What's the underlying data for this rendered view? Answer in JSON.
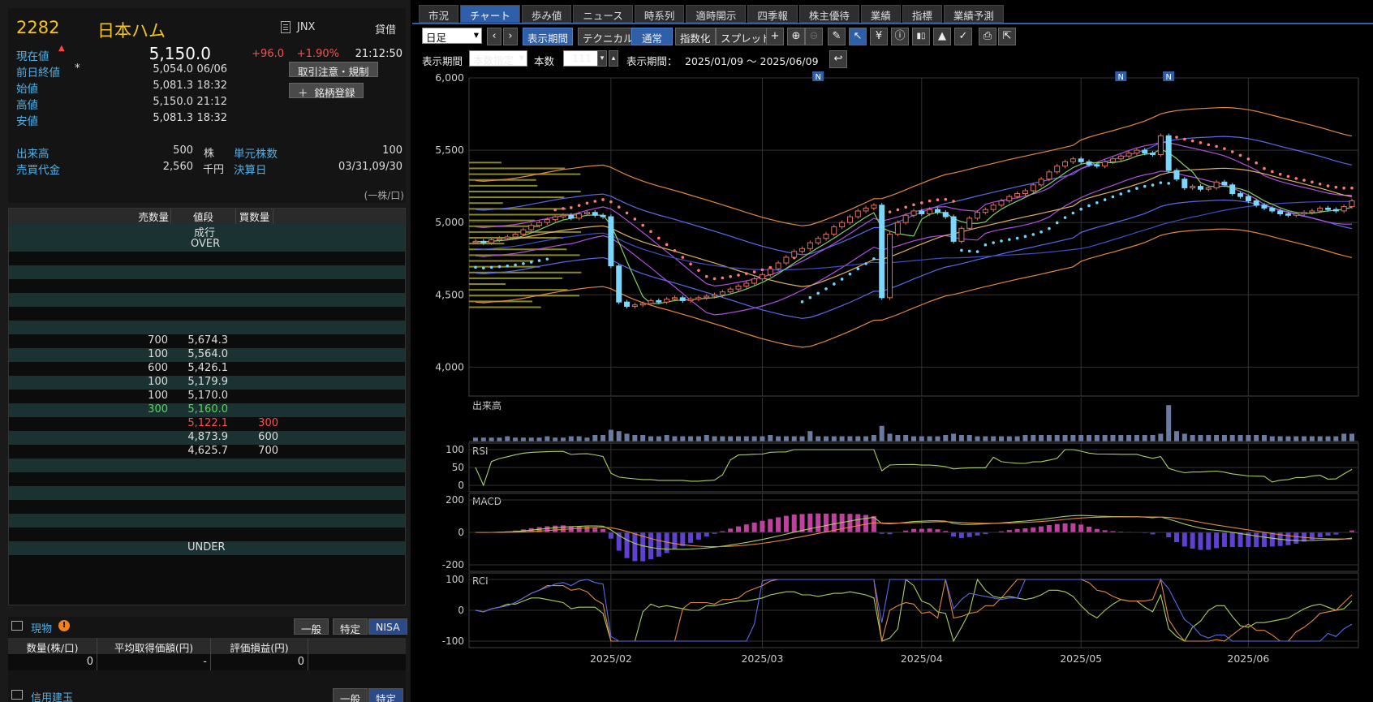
{
  "quote": {
    "code": "2282",
    "name": "日本ハム",
    "market": "JNX",
    "lend_label": "貸借",
    "current_label": "現在値",
    "current_value": "5,150.0",
    "change": "+96.0",
    "change_pct": "+1.90%",
    "time": "21:12:50",
    "prev_close_label": "前日終値",
    "prev_close_mark": "*",
    "prev_close": "5,054.0",
    "prev_close_date": "06/06",
    "open_label": "始値",
    "open": "5,081.3",
    "open_time": "18:32",
    "high_label": "高値",
    "high": "5,150.0",
    "high_time": "21:12",
    "low_label": "安値",
    "low": "5,081.3",
    "low_time": "18:32",
    "volume_label": "出来高",
    "volume": "500",
    "volume_unit": "株",
    "unit_shares_label": "単元株数",
    "unit_shares": "100",
    "turnover_label": "売買代金",
    "turnover": "2,560",
    "turnover_unit": "千円",
    "settlement_label": "決算日",
    "settlement": "03/31,09/30",
    "per_note": "(一株/口)",
    "btn_notice": "取引注意・規制",
    "btn_register": "銘柄登録"
  },
  "board": {
    "headers": [
      "売数量",
      "値段",
      "買数量"
    ],
    "market_order": "成行",
    "over": "OVER",
    "under": "UNDER",
    "rows": [
      {
        "sell": "700",
        "price": "5,674.3",
        "buy": ""
      },
      {
        "sell": "100",
        "price": "5,564.0",
        "buy": ""
      },
      {
        "sell": "600",
        "price": "5,426.1",
        "buy": ""
      },
      {
        "sell": "100",
        "price": "5,179.9",
        "buy": ""
      },
      {
        "sell": "100",
        "price": "5,170.0",
        "buy": ""
      },
      {
        "sell": "300",
        "price": "5,160.0",
        "buy": ""
      },
      {
        "sell": "",
        "price": "5,122.1",
        "buy": "300"
      },
      {
        "sell": "",
        "price": "4,873.9",
        "buy": "600"
      },
      {
        "sell": "",
        "price": "4,625.7",
        "buy": "700"
      }
    ]
  },
  "holdings": {
    "title": "現物",
    "warn": "!",
    "seg": [
      "一般",
      "特定",
      "NISA"
    ],
    "headers": [
      "数量(株/口)",
      "平均取得価額(円)",
      "評価損益(円)"
    ],
    "row": [
      "0",
      "-",
      "0"
    ],
    "next_title": "信用建玉",
    "next_seg": [
      "一般",
      "特定"
    ]
  },
  "tabs": [
    "市況",
    "チャート",
    "歩み値",
    "ニュース",
    "時系列",
    "適時開示",
    "四季報",
    "株主優待",
    "業績",
    "指標",
    "業績予測"
  ],
  "toolbar": {
    "period_select": "日足",
    "display_period_btn": "表示期間",
    "technical_btn": "テクニカル",
    "normal_btn": "通常",
    "index_btn": "指数化",
    "spread_btn": "スプレッド",
    "row2_label": "表示期間",
    "row2_select": "本数指定",
    "count_label": "本数",
    "count_value": "111",
    "range_label": "表示期間：",
    "range_value": "2025/01/09 ～ 2025/06/09"
  },
  "chart_data": {
    "type": "candlestick",
    "price_ticks": [
      "6,000",
      "5,500",
      "5,000",
      "4,500",
      "4,000"
    ],
    "ylim": [
      3800,
      6000
    ],
    "x_ticks": [
      "2025/02",
      "2025/03",
      "2025/04",
      "2025/05",
      "2025/06"
    ],
    "news_markers": [
      "N",
      "N",
      "N"
    ],
    "volume_label": "出来高",
    "rsi_label": "RSI",
    "rsi_ticks": [
      "100",
      "50",
      "0"
    ],
    "macd_label": "MACD",
    "macd_ticks": [
      "200",
      "0",
      "-200"
    ],
    "rci_label": "RCI",
    "rci_ticks": [
      "100",
      "0",
      "-100"
    ],
    "close_series": [
      4870,
      4860,
      4880,
      4890,
      4900,
      4920,
      4950,
      4980,
      5000,
      5020,
      5040,
      5050,
      5030,
      5060,
      5070,
      5050,
      5040,
      4700,
      4450,
      4420,
      4430,
      4440,
      4460,
      4450,
      4470,
      4480,
      4460,
      4470,
      4480,
      4490,
      4500,
      4520,
      4540,
      4560,
      4580,
      4610,
      4640,
      4680,
      4720,
      4760,
      4800,
      4820,
      4860,
      4890,
      4920,
      4970,
      5000,
      5040,
      5080,
      5100,
      5120,
      4480,
      4920,
      5000,
      5050,
      5080,
      5060,
      5090,
      5070,
      5040,
      4870,
      4960,
      5030,
      5070,
      5090,
      5120,
      5150,
      5180,
      5200,
      5220,
      5260,
      5300,
      5350,
      5390,
      5420,
      5440,
      5420,
      5400,
      5390,
      5420,
      5440,
      5460,
      5480,
      5500,
      5480,
      5470,
      5600,
      5360,
      5300,
      5240,
      5250,
      5230,
      5240,
      5280,
      5260,
      5200,
      5180,
      5150,
      5120,
      5100,
      5080,
      5060,
      5050,
      5060,
      5070,
      5080,
      5100,
      5090,
      5080,
      5110,
      5150
    ],
    "volume_series": [
      3,
      3,
      3,
      3,
      4,
      3,
      3,
      3,
      3,
      4,
      3,
      3,
      4,
      4,
      3,
      5,
      5,
      9,
      8,
      6,
      5,
      5,
      4,
      4,
      5,
      4,
      4,
      4,
      4,
      5,
      4,
      4,
      4,
      4,
      4,
      4,
      4,
      5,
      4,
      4,
      4,
      4,
      8,
      4,
      4,
      4,
      4,
      4,
      4,
      4,
      5,
      12,
      6,
      5,
      5,
      4,
      4,
      4,
      4,
      5,
      6,
      5,
      5,
      4,
      4,
      4,
      4,
      4,
      4,
      5,
      5,
      5,
      5,
      5,
      5,
      5,
      5,
      5,
      5,
      5,
      5,
      5,
      5,
      5,
      5,
      5,
      6,
      28,
      8,
      6,
      5,
      5,
      5,
      5,
      5,
      5,
      5,
      5,
      5,
      5,
      4,
      4,
      4,
      4,
      4,
      4,
      4,
      4,
      4,
      6,
      6
    ]
  }
}
